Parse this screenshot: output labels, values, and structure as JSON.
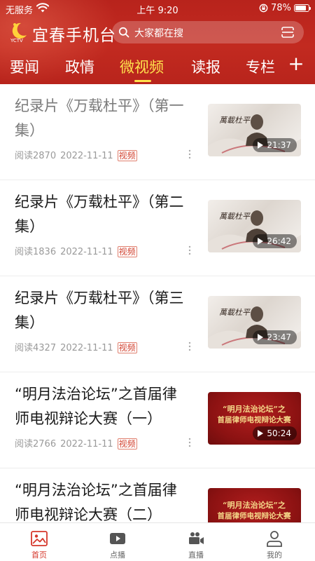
{
  "status_bar": {
    "carrier": "无服务",
    "time": "上午 9:20",
    "battery": "78%",
    "battery_level": 0.78
  },
  "header": {
    "app_title": "宜春手机台",
    "search_placeholder": "大家都在搜",
    "brand_color": "#c22a20",
    "active_tab_color": "#ffe14d"
  },
  "tabs": [
    {
      "label": "要闻",
      "active": false
    },
    {
      "label": "政情",
      "active": false
    },
    {
      "label": "微视频",
      "active": true
    },
    {
      "label": "读报",
      "active": false
    },
    {
      "label": "专栏",
      "active": false
    }
  ],
  "tab_more": "+",
  "articles": [
    {
      "title": "纪录片《万载杜平》（第一集）",
      "reads": "阅读2870",
      "date": "2022-11-11",
      "tag": "视频",
      "duration": "21:37",
      "thumb": "documentary",
      "thumb_text": "萬載杜平",
      "read": true
    },
    {
      "title": "纪录片《万载杜平》（第二集）",
      "reads": "阅读1836",
      "date": "2022-11-11",
      "tag": "视频",
      "duration": "26:42",
      "thumb": "documentary",
      "thumb_text": "萬載杜平",
      "read": false
    },
    {
      "title": "纪录片《万载杜平》（第三集）",
      "reads": "阅读4327",
      "date": "2022-11-11",
      "tag": "视频",
      "duration": "23:47",
      "thumb": "documentary",
      "thumb_text": "萬載杜平",
      "read": false
    },
    {
      "title": "“明月法治论坛”之首届律师电视辩论大赛（一）",
      "reads": "阅读2766",
      "date": "2022-11-11",
      "tag": "视频",
      "duration": "50:24",
      "thumb": "debate",
      "thumb_text": "“明月法治论坛”之",
      "thumb_text2": "首届律师电视辩论大赛",
      "read": false
    },
    {
      "title": "“明月法治论坛”之首届律师电视辩论大赛（二）",
      "reads": "",
      "date": "",
      "tag": "",
      "duration": "",
      "thumb": "debate",
      "thumb_text": "“明月法治论坛”之",
      "thumb_text2": "首届律师电视辩论大赛",
      "read": false
    }
  ],
  "bottom_nav": [
    {
      "label": "首页",
      "icon": "home-picture-icon",
      "active": true
    },
    {
      "label": "点播",
      "icon": "play-icon",
      "active": false
    },
    {
      "label": "直播",
      "icon": "video-camera-icon",
      "active": false
    },
    {
      "label": "我的",
      "icon": "user-icon",
      "active": false
    }
  ]
}
